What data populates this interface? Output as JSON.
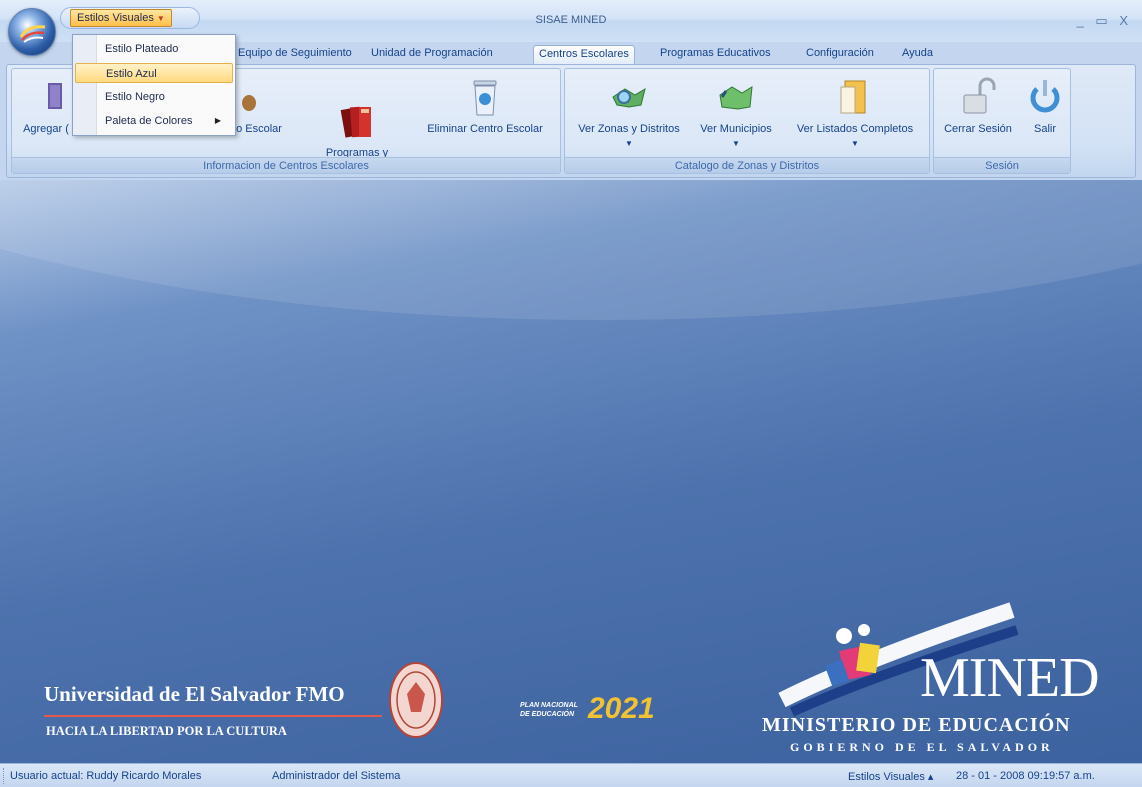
{
  "window": {
    "title": "SISAE MINED",
    "controls": "_ ▭ X"
  },
  "qat": {
    "estilos_label": "Estilos Visuales"
  },
  "menu": {
    "items": [
      "Estilo Plateado",
      "Estilo Azul",
      "Estilo Negro",
      "Paleta de Colores"
    ],
    "highlighted": "Estilo Azul"
  },
  "tabs": [
    "Equipo de Seguimiento",
    "Unidad de Programación",
    "Centros Escolares",
    "Programas Educativos",
    "Configuración",
    "Ayuda"
  ],
  "active_tab": "Centros Escolares",
  "ribbon": {
    "group1": {
      "label": "Informacion de Centros Escolares",
      "buttons": [
        "Agregar (",
        "o Escolar",
        "Programas y\nProyectos Asignados",
        "Eliminar Centro Escolar"
      ]
    },
    "group2": {
      "label": "Catalogo de Zonas y Distritos",
      "buttons": [
        "Ver Zonas y Distritos",
        "Ver Municipios",
        "Ver Listados Completos"
      ]
    },
    "group3": {
      "label": "Sesión",
      "buttons": [
        "Cerrar Sesión",
        "Salir"
      ]
    }
  },
  "branding": {
    "ues_title": "Universidad de El Salvador  FMO",
    "ues_motto": "HACIA LA LIBERTAD POR LA CULTURA",
    "plan_text_1": "PLAN NACIONAL",
    "plan_text_2": "DE EDUCACIÓN",
    "plan_logo": "2021",
    "mined_word": "MINED",
    "mined_ministry": "MINISTERIO DE EDUCACIÓN",
    "mined_gov": "GOBIERNO DE EL SALVADOR"
  },
  "status": {
    "user": "Usuario actual:  Ruddy Ricardo Morales",
    "role": "Administrador del Sistema",
    "styles": "Estilos Visuales  ▴",
    "datetime": "28 - 01 - 2008  09:19:57 a.m."
  },
  "colors": {
    "accent": "#ffbf4a",
    "ribbon_text": "#15428b",
    "workspace": "#4d72ad",
    "ues_line": "#e4584b"
  }
}
